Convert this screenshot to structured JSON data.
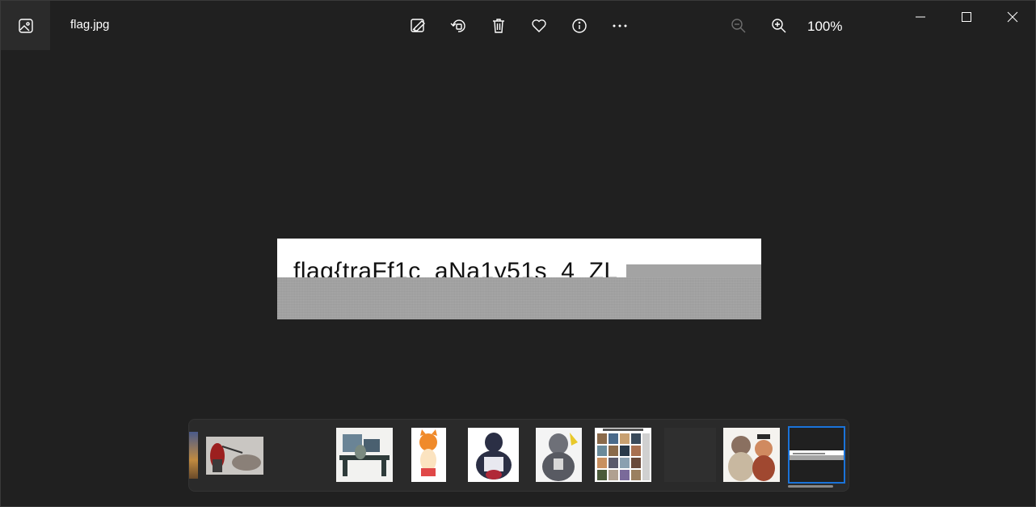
{
  "titlebar": {
    "file_name": "flag.jpg",
    "zoom_level": "100%"
  },
  "toolbar": {
    "buttons": [
      {
        "icon": "edit-image-icon"
      },
      {
        "icon": "rotate-icon"
      },
      {
        "icon": "delete-icon"
      },
      {
        "icon": "favorite-heart-icon"
      },
      {
        "icon": "info-icon"
      },
      {
        "icon": "more-options-icon"
      }
    ],
    "zoom_out_icon": "zoom-out-icon",
    "zoom_in_icon": "zoom-in-icon"
  },
  "window_controls": {
    "minimize": "minimize-icon",
    "maximize": "maximize-icon",
    "close": "close-icon"
  },
  "image": {
    "visible_text": "flag{traFf1c_aNa1y51s_4_ZL"
  },
  "filmstrip": {
    "selected_index": 9
  },
  "colors": {
    "background": "#202020",
    "topbar_icon_box": "#2b2b2b",
    "selection_outline": "#1a73d9"
  }
}
